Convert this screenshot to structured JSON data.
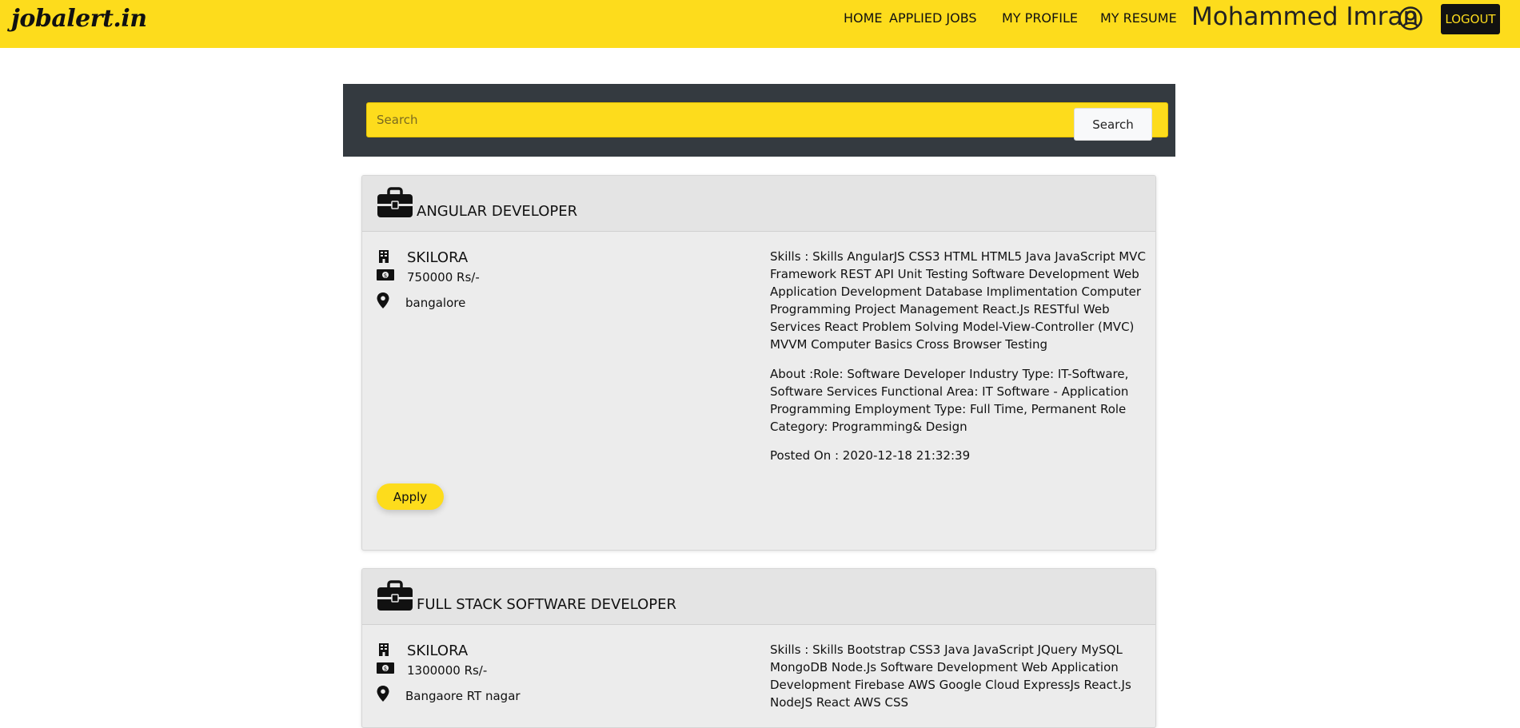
{
  "app": {
    "brand": "jobalert.in"
  },
  "nav": {
    "home": "HOME",
    "applied_jobs": "APPLIED JOBS",
    "my_profile": "MY PROFILE",
    "my_resume": "MY RESUME",
    "username": "Mohammed Imran",
    "logout": "LOGOUT"
  },
  "search": {
    "placeholder": "Search",
    "button_label": "Search"
  },
  "jobs": [
    {
      "title": "ANGULAR DEVELOPER",
      "company": "SKILORA",
      "salary": "750000 Rs/-",
      "location": "bangalore",
      "skills": "Skills : Skills AngularJS CSS3 HTML HTML5 Java JavaScript MVC Framework REST API Unit Testing Software Development Web Application Development Database Implimentation Computer Programming Project Management React.Js RESTful Web Services React Problem Solving Model-View-Controller (MVC) MVVM Computer Basics Cross Browser Testing",
      "about": "About :Role: Software Developer Industry Type: IT-Software, Software Services Functional Area: IT Software - Application Programming Employment Type: Full Time, Permanent Role Category: Programming& Design",
      "posted": "Posted On : 2020-12-18 21:32:39",
      "apply_label": "Apply"
    },
    {
      "title": "FULL STACK SOFTWARE DEVELOPER",
      "company": "SKILORA",
      "salary": "1300000 Rs/-",
      "location": "Bangaore RT nagar",
      "skills": "Skills : Skills Bootstrap CSS3 Java JavaScript JQuery MySQL MongoDB Node.Js Software Development Web Application Development Firebase AWS Google Cloud ExpressJs React.Js NodeJS React AWS CSS"
    }
  ],
  "colors": {
    "accent": "#fddc1c",
    "panel": "#343a40",
    "card": "#ececec"
  }
}
